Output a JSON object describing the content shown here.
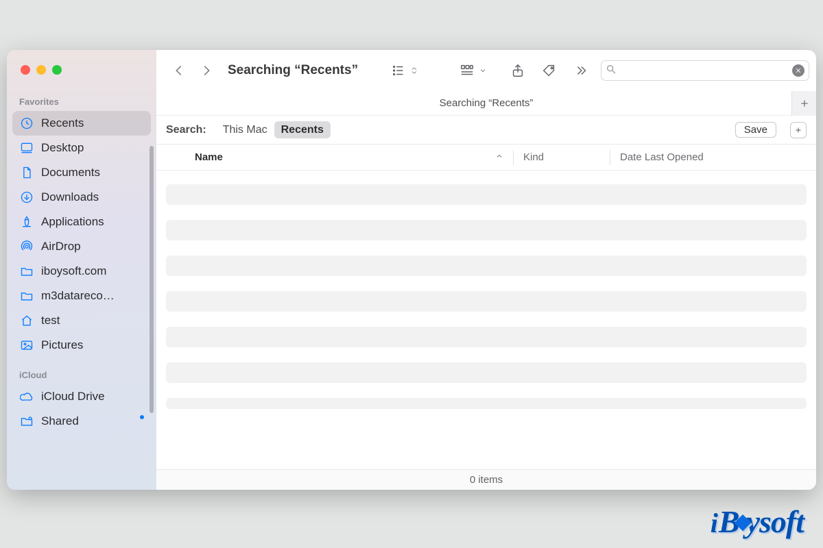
{
  "window": {
    "title": "Searching “Recents”",
    "pathline": "Searching “Recents”"
  },
  "sidebar": {
    "sections": {
      "favorites": "Favorites",
      "icloud": "iCloud"
    },
    "favorites": [
      {
        "icon": "clock",
        "label": "Recents",
        "selected": true
      },
      {
        "icon": "desktop",
        "label": "Desktop"
      },
      {
        "icon": "doc",
        "label": "Documents"
      },
      {
        "icon": "download",
        "label": "Downloads"
      },
      {
        "icon": "apps",
        "label": "Applications"
      },
      {
        "icon": "airdrop",
        "label": "AirDrop"
      },
      {
        "icon": "folder",
        "label": "iboysoft.com"
      },
      {
        "icon": "folder",
        "label": "m3datareco…"
      },
      {
        "icon": "house",
        "label": "test"
      },
      {
        "icon": "image",
        "label": "Pictures"
      }
    ],
    "icloud": [
      {
        "icon": "cloud",
        "label": "iCloud Drive"
      },
      {
        "icon": "sharefolder",
        "label": "Shared",
        "badge": true
      }
    ]
  },
  "search": {
    "label": "Search:",
    "scopes": [
      {
        "label": "This Mac",
        "active": false
      },
      {
        "label": "Recents",
        "active": true
      }
    ],
    "save": "Save"
  },
  "columns": {
    "name": "Name",
    "kind": "Kind",
    "date": "Date Last Opened"
  },
  "status": {
    "items": "0 items"
  },
  "brand": "iBoysoft"
}
